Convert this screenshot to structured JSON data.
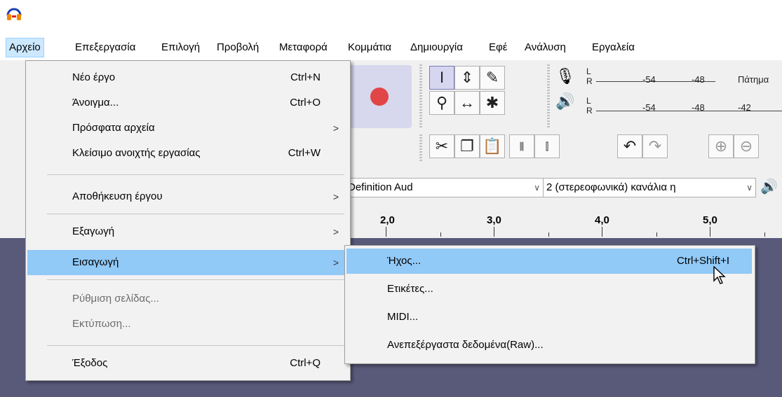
{
  "app": {
    "icon": "audacity-headphones-icon"
  },
  "menubar": {
    "items": [
      "Αρχείο",
      "Επεξεργασία",
      "Επιλογή",
      "Προβολή",
      "Μεταφορά",
      "Κομμάτια",
      "Δημιουργία",
      "Εφέ",
      "Ανάλυση",
      "Εργαλεία"
    ],
    "active": "Αρχείο"
  },
  "file_menu": {
    "items": [
      {
        "label": "Νέο έργο",
        "shortcut": "Ctrl+N"
      },
      {
        "label": "Άνοιγμα...",
        "shortcut": "Ctrl+O"
      },
      {
        "label": "Πρόσφατα αρχεία",
        "submenu": ">"
      },
      {
        "label": "Κλείσιμο ανοιχτής εργασίας",
        "shortcut": "Ctrl+W"
      },
      {
        "label": "Αποθήκευση έργου",
        "submenu": ">"
      },
      {
        "label": "Εξαγωγή",
        "submenu": ">"
      },
      {
        "label": "Εισαγωγή",
        "submenu": ">",
        "highlighted": true
      },
      {
        "label": "Ρύθμιση σελίδας...",
        "disabled": true
      },
      {
        "label": "Εκτύπωση...",
        "disabled": true
      },
      {
        "label": "Έξοδος",
        "shortcut": "Ctrl+Q"
      }
    ]
  },
  "import_menu": {
    "items": [
      {
        "label": "Ήχος...",
        "shortcut": "Ctrl+Shift+I",
        "highlighted": true
      },
      {
        "label": "Ετικέτες..."
      },
      {
        "label": "MIDI..."
      },
      {
        "label": "Ανεπεξέργαστα δεδομένα(Raw)..."
      }
    ]
  },
  "toolbar": {
    "meter_labels_top": [
      "-54",
      "-48",
      "Πάτημα"
    ],
    "meter_labels_bottom": [
      "-54",
      "-48",
      "-42"
    ],
    "lr": [
      "L",
      "R"
    ],
    "icons": [
      "ibeam-icon",
      "envelope-icon",
      "pencil-icon",
      "microphone-icon",
      "zoom-icon",
      "timeshift-icon",
      "multi-tool-icon",
      "speaker-icon",
      "cut-icon",
      "copy-icon",
      "paste-icon",
      "trim-icon",
      "silence-icon",
      "undo-icon",
      "redo-icon",
      "zoom-in-icon",
      "zoom-out-icon"
    ],
    "record_color": "#e24545"
  },
  "devices": {
    "host_partial": "Definition Aud",
    "channels": "2 (στερεοφωνικά) κανάλια η"
  },
  "ruler": {
    "labels": [
      "2,0",
      "3,0",
      "4,0",
      "5,0"
    ]
  },
  "colors": {
    "track_bg": "#595a7a",
    "highlight": "#91c9f7",
    "menu_active": "#cce8ff"
  }
}
